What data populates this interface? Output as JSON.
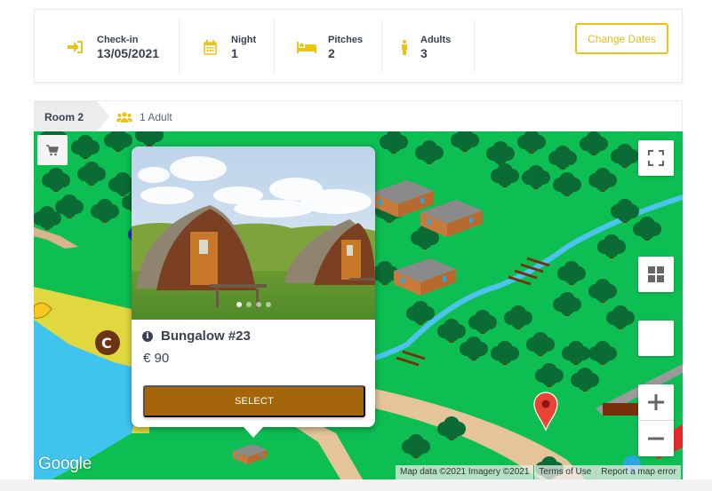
{
  "summary": {
    "items": [
      {
        "icon": "sign-in-icon",
        "label": "Check-in",
        "value": "13/05/2021"
      },
      {
        "icon": "calendar-icon",
        "label": "Night",
        "value": "1"
      },
      {
        "icon": "bed-icon",
        "label": "Pitches",
        "value": "2"
      },
      {
        "icon": "person-icon",
        "label": "Adults",
        "value": "3"
      }
    ],
    "change_dates_label": "Change Dates"
  },
  "room": {
    "tab_label": "Room 2",
    "guests_icon": "users-icon",
    "guests_label": "1 Adult"
  },
  "map": {
    "google_logo": "Google",
    "attribution": {
      "map_data": "Map data ©2021 Imagery ©2021",
      "terms": "Terms of Use",
      "report": "Report a map error"
    },
    "controls": {
      "cart": "cart-icon",
      "fullscreen": "fullscreen-icon",
      "layers": "grid-icon",
      "zoom_in": "+",
      "zoom_out": "−"
    }
  },
  "infowindow": {
    "title": "Bungalow #23",
    "price": "€ 90",
    "select_label": "SELECT",
    "photo_count": 4,
    "active_photo": 1
  },
  "colors": {
    "accent_yellow": "#ecc315",
    "select_brown": "#a5660b",
    "text_dark": "#3a4150",
    "map_green": "#0dbf52"
  }
}
